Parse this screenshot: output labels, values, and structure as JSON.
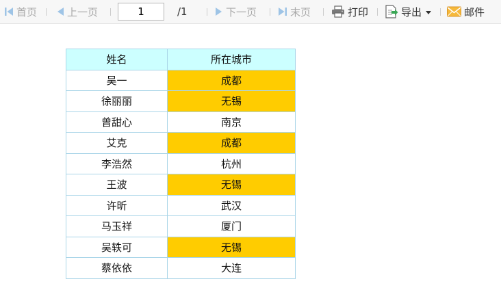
{
  "toolbar": {
    "first_label": "首页",
    "prev_label": "上一页",
    "page_value": "1",
    "page_total": "/1",
    "next_label": "下一页",
    "last_label": "末页",
    "print_label": "打印",
    "export_label": "导出",
    "mail_label": "邮件"
  },
  "colors": {
    "header_bg": "#ccffff",
    "highlight_bg": "#ffcc00",
    "border": "#a9d5e8",
    "nav_disabled": "#a9a9a9",
    "nav_arrow": "#9ec4e6"
  },
  "icons": {
    "first": "first-page-icon",
    "prev": "prev-page-icon",
    "next": "next-page-icon",
    "last": "last-page-icon",
    "print": "printer-icon",
    "export": "export-icon",
    "mail": "mail-envelope-icon"
  },
  "table": {
    "headers": [
      "姓名",
      "所在城市"
    ],
    "rows": [
      {
        "name": "吴一",
        "city": "成都",
        "highlight": true
      },
      {
        "name": "徐丽丽",
        "city": "无锡",
        "highlight": true
      },
      {
        "name": "曾甜心",
        "city": "南京",
        "highlight": false
      },
      {
        "name": "艾克",
        "city": "成都",
        "highlight": true
      },
      {
        "name": "李浩然",
        "city": "杭州",
        "highlight": false
      },
      {
        "name": "王波",
        "city": "无锡",
        "highlight": true
      },
      {
        "name": "许昕",
        "city": "武汉",
        "highlight": false
      },
      {
        "name": "马玉祥",
        "city": "厦门",
        "highlight": false
      },
      {
        "name": "吴轶可",
        "city": "无锡",
        "highlight": true
      },
      {
        "name": "蔡依依",
        "city": "大连",
        "highlight": false
      }
    ]
  }
}
